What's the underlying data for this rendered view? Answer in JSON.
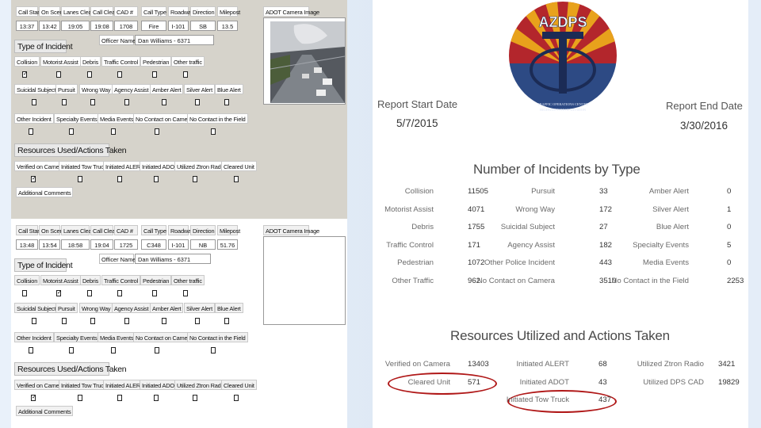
{
  "form1": {
    "headers": [
      "Call Start",
      "On Scene",
      "Lanes Clear",
      "Call Clear",
      "CAD #",
      "Call Type",
      "Roadway",
      "Direction",
      "Milepost"
    ],
    "values": [
      "13:37",
      "13:42",
      "19:05",
      "19:08",
      "1708",
      "Fire",
      "I-101",
      "SB",
      "13.5"
    ],
    "camera_label": "ADOT Camera Image",
    "type_of_incident": "Type of Incident",
    "officer_label": "Officer Name",
    "officer_value": "Dan Williams - 6371",
    "row1": [
      "Collision",
      "Motorist Assist",
      "Debris",
      "Traffic Control",
      "Pedestrian",
      "Other traffic"
    ],
    "row2": [
      "Suicidal Subject",
      "Pursuit",
      "Wrong Way",
      "Agency Assist",
      "Amber Alert",
      "Silver Alert",
      "Blue Alert"
    ],
    "row3": [
      "Other Incident",
      "Specialty Events",
      "Media Events",
      "No Contact on Camera",
      "No Contact in the Field"
    ],
    "resources_title": "Resources Used/Actions Taken",
    "row4": [
      "Verified on Camera",
      "Initiated Tow Truck",
      "Initiated ALERT",
      "Initiated ADOT",
      "Utilized Ztron Radio",
      "Cleared Unit"
    ],
    "additional_comments": "Additional Comments",
    "checked_mark": "✓"
  },
  "form2": {
    "headers": [
      "Call Start",
      "On Scene",
      "Lanes Clear",
      "Call Clear",
      "CAD #",
      "Call Type",
      "Roadway",
      "Direction",
      "Milepost"
    ],
    "values": [
      "13:48",
      "13:54",
      "18:58",
      "19:04",
      "1725",
      "C348",
      "I-101",
      "NB",
      "51.76"
    ],
    "camera_label": "ADOT Camera Image",
    "type_of_incident": "Type of Incident",
    "officer_label": "Officer Name",
    "officer_value": "Dan Williams - 6371",
    "row1": [
      "Collision",
      "Motorist Assist",
      "Debris",
      "Traffic Control",
      "Pedestrian",
      "Other traffic"
    ],
    "row2": [
      "Suicidal Subject",
      "Pursuit",
      "Wrong Way",
      "Agency Assist",
      "Amber Alert",
      "Silver Alert",
      "Blue Alert"
    ],
    "row3": [
      "Other Incident",
      "Specialty Events",
      "Media Events",
      "No Contact on Camera",
      "No Contact in the Field"
    ],
    "resources_title": "Resources Used/Actions Taken",
    "row4": [
      "Verified on Camera",
      "Initiated Tow Truck",
      "Initiated ALERT",
      "Initiated ADOT",
      "Utilized Ztron Radio",
      "Cleared Unit"
    ],
    "additional_comments": "Additional Comments",
    "checked_mark": "✓"
  },
  "report": {
    "logo_text": "AZDPS",
    "logo_caption_1": "TRAFFIC OPERATIONS CENTER",
    "logo_caption_2": "HIGHWAY PATROL DIVISION",
    "start_label": "Report Start Date",
    "start_date": "5/7/2015",
    "end_label": "Report End Date",
    "end_date": "3/30/2016",
    "incidents_title": "Number of Incidents by Type",
    "incidents": [
      [
        [
          "Collision",
          "11505"
        ],
        [
          "Pursuit",
          "33"
        ],
        [
          "Amber Alert",
          "0"
        ]
      ],
      [
        [
          "Motorist Assist",
          "4071"
        ],
        [
          "Wrong Way",
          "172"
        ],
        [
          "Silver Alert",
          "1"
        ]
      ],
      [
        [
          "Debris",
          "1755"
        ],
        [
          "Suicidal Subject",
          "27"
        ],
        [
          "Blue Alert",
          "0"
        ]
      ],
      [
        [
          "Traffic Control",
          "171"
        ],
        [
          "Agency Assist",
          "182"
        ],
        [
          "Specialty Events",
          "5"
        ]
      ],
      [
        [
          "Pedestrian",
          "1072"
        ],
        [
          "Other Police Incident",
          "443"
        ],
        [
          "Media Events",
          "0"
        ]
      ],
      [
        [
          "Other Traffic",
          "962"
        ],
        [
          "No Contact on Camera",
          "3510"
        ],
        [
          "No Contact in the Field",
          "2253"
        ]
      ]
    ],
    "resources_title": "Resources Utilized and Actions Taken",
    "resources": [
      [
        [
          "Verified on Camera",
          "13403"
        ],
        [
          "Initiated ALERT",
          "68"
        ],
        [
          "Utilized Ztron Radio",
          "3421"
        ]
      ],
      [
        [
          "Cleared Unit",
          "571"
        ],
        [
          "Initiated ADOT",
          "43"
        ],
        [
          "Utilized DPS CAD",
          "19829"
        ]
      ],
      [
        [
          "",
          ""
        ],
        [
          "Initiated Tow Truck",
          "437"
        ],
        [
          "",
          ""
        ]
      ]
    ],
    "colors": {
      "accent_red": "#b01818",
      "logo_blue": "#2d4a84",
      "logo_gold": "#e8a21c",
      "logo_red": "#b3262c"
    }
  }
}
